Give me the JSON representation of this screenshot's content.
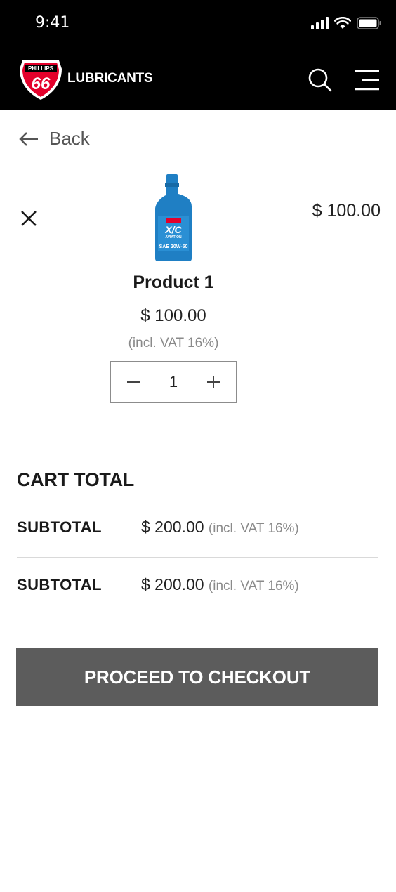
{
  "status_bar": {
    "time": "9:41"
  },
  "header": {
    "logo_text": "PHILLIPS 66",
    "brand": "LUBRICANTS",
    "icons": {
      "search": "search-icon",
      "menu": "hamburger-menu-icon"
    }
  },
  "back": {
    "label": "Back"
  },
  "cart_item": {
    "name": "Product 1",
    "line_price": "$ 100.00",
    "unit_price": "$ 100.00",
    "vat_note": "(incl. VAT 16%)",
    "quantity": "1",
    "image_label": "X/C AVIATION SAE 20W-50"
  },
  "cart_total": {
    "title": "CART TOTAL",
    "rows": [
      {
        "label": "SUBTOTAL",
        "value": "$ 200.00",
        "vat": "(incl. VAT 16%)"
      },
      {
        "label": "SUBTOTAL",
        "value": "$ 200.00",
        "vat": "(incl. VAT 16%)"
      }
    ]
  },
  "checkout": {
    "label": "PROCEED TO CHECKOUT"
  },
  "colors": {
    "header_bg": "#000000",
    "logo_red": "#e4002b",
    "checkout_bg": "#5c5c5c",
    "bottle_blue": "#1f7fc4",
    "muted_text": "#8a8a8a"
  }
}
